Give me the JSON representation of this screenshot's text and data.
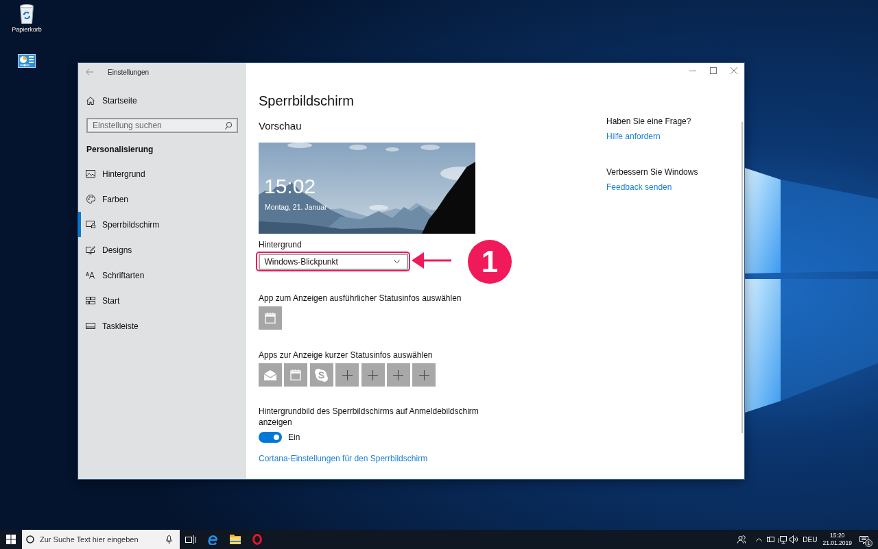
{
  "desktop": {
    "icons": [
      {
        "kind": "recycle-bin",
        "label": "Papierkorb"
      },
      {
        "kind": "dashboard"
      }
    ]
  },
  "window": {
    "title": "Einstellungen"
  },
  "sidebar": {
    "home": "Startseite",
    "search": {
      "placeholder": "Einstellung suchen"
    },
    "section": "Personalisierung",
    "items": [
      {
        "kind": "picture",
        "label": "Hintergrund",
        "selected": false
      },
      {
        "kind": "palette",
        "label": "Farben",
        "selected": false
      },
      {
        "kind": "lock-screen",
        "label": "Sperrbildschirm",
        "selected": true
      },
      {
        "kind": "brush",
        "label": "Designs",
        "selected": false
      },
      {
        "kind": "fonts",
        "label": "Schriftarten",
        "selected": false
      },
      {
        "kind": "tiles",
        "label": "Start",
        "selected": false
      },
      {
        "kind": "taskbar",
        "label": "Taskleiste",
        "selected": false
      }
    ]
  },
  "page": {
    "title": "Sperrbildschirm",
    "preview": {
      "heading": "Vorschau",
      "time": "15:02",
      "date": "Montag, 21. Januar"
    },
    "background": {
      "label": "Hintergrund",
      "value": "Windows-Blickpunkt"
    },
    "detailed_status": {
      "label": "App zum Anzeigen ausführlicher Statusinfos auswählen",
      "apps": [
        {
          "kind": "calendar"
        }
      ]
    },
    "quick_status": {
      "label": "Apps zur Anzeige kurzer Statusinfos auswählen",
      "apps": [
        {
          "kind": "mail"
        },
        {
          "kind": "calendar"
        },
        {
          "kind": "s-chat"
        },
        {
          "kind": "add"
        },
        {
          "kind": "add"
        },
        {
          "kind": "add"
        },
        {
          "kind": "add"
        }
      ]
    },
    "signin_background": {
      "label": "Hintergrundbild des Sperrbildschirms auf Anmeldebildschirm anzeigen",
      "on": true,
      "state": "Ein"
    },
    "links": [
      "Cortana-Einstellungen für den Sperrbildschirm"
    ]
  },
  "annotation": {
    "number": "1"
  },
  "help": [
    {
      "heading": "Haben Sie eine Frage?",
      "link": "Hilfe anfordern"
    },
    {
      "heading": "Verbessern Sie Windows",
      "link": "Feedback senden"
    }
  ],
  "taskbar": {
    "search": {
      "placeholder": "Zur Suche Text hier eingeben"
    },
    "apps": [
      {
        "kind": "task-view"
      },
      {
        "kind": "letter-e"
      },
      {
        "kind": "folder"
      },
      {
        "kind": "ring"
      }
    ],
    "tray": {
      "language": "DEU",
      "time": "15:20",
      "date": "21.01.2019",
      "notifications": "1"
    }
  }
}
